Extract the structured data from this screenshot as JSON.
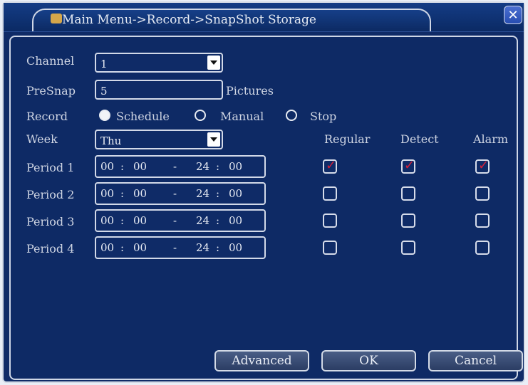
{
  "window": {
    "title": "Main Menu->Record->SnapShot Storage",
    "close_symbol": "✕"
  },
  "form": {
    "channel": {
      "label": "Channel",
      "value": "1"
    },
    "presnap": {
      "label": "PreSnap",
      "value": "5",
      "unit": "Pictures"
    },
    "record": {
      "label": "Record",
      "options": [
        {
          "label": "Schedule",
          "selected": true
        },
        {
          "label": "Manual",
          "selected": false
        },
        {
          "label": "Stop",
          "selected": false
        }
      ]
    },
    "week": {
      "label": "Week",
      "value": "Thu"
    },
    "columns": [
      "Regular",
      "Detect",
      "Alarm"
    ],
    "periods": [
      {
        "label": "Period 1",
        "start_h": "00",
        "start_m": "00",
        "end_h": "24",
        "end_m": "00",
        "sep": ":",
        "dash": "-",
        "checks": [
          true,
          true,
          true
        ]
      },
      {
        "label": "Period 2",
        "start_h": "00",
        "start_m": "00",
        "end_h": "24",
        "end_m": "00",
        "sep": ":",
        "dash": "-",
        "checks": [
          false,
          false,
          false
        ]
      },
      {
        "label": "Period 3",
        "start_h": "00",
        "start_m": "00",
        "end_h": "24",
        "end_m": "00",
        "sep": ":",
        "dash": "-",
        "checks": [
          false,
          false,
          false
        ]
      },
      {
        "label": "Period 4",
        "start_h": "00",
        "start_m": "00",
        "end_h": "24",
        "end_m": "00",
        "sep": ":",
        "dash": "-",
        "checks": [
          false,
          false,
          false
        ]
      }
    ]
  },
  "buttons": {
    "advanced": "Advanced",
    "ok": "OK",
    "cancel": "Cancel"
  },
  "colors": {
    "background": "#0f2b67",
    "border": "#d3dae6",
    "check": "#d4203a"
  }
}
